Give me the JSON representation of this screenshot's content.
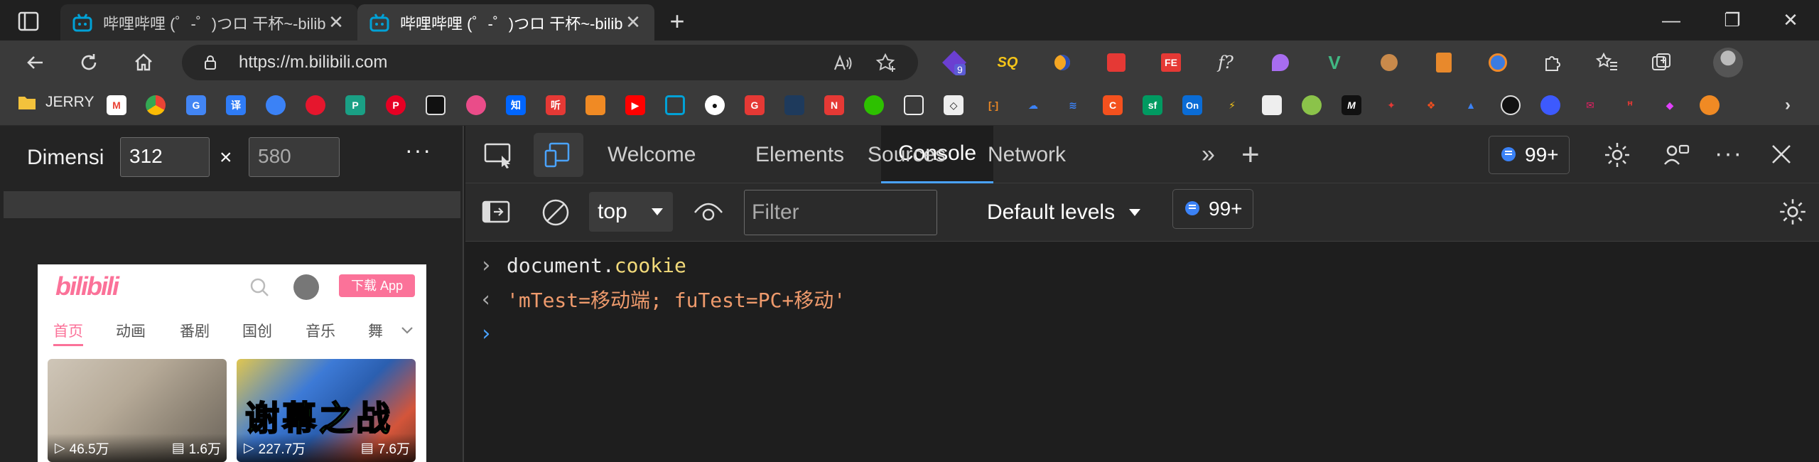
{
  "browser": {
    "tabs": [
      {
        "title": "哔哩哔哩 (゜-゜)つロ 干杯~-bilibili",
        "close": "✕"
      },
      {
        "title": "哔哩哔哩 (゜-゜)つロ 干杯~-bilibili",
        "close": "✕"
      }
    ],
    "new_tab": "+",
    "window": {
      "minimize": "—",
      "restore": "❐",
      "close": "✕"
    },
    "url": "https://m.bilibili.com",
    "extension_badge": "9",
    "bookmark_folder": "JERRY"
  },
  "device": {
    "dimension_label": "Dimensi",
    "width": "312",
    "height": "580",
    "x": "×",
    "more": "···"
  },
  "page": {
    "logo": "bilibili",
    "download_btn": "下载 App",
    "nav": [
      "首页",
      "动画",
      "番剧",
      "国创",
      "音乐",
      "舞"
    ],
    "cards": [
      {
        "views": "46.5万",
        "comments": "1.6万",
        "overlay": ""
      },
      {
        "views": "227.7万",
        "comments": "7.6万",
        "overlay": "谢幕之战"
      }
    ]
  },
  "devtools": {
    "tabs": [
      "Welcome",
      "Elements",
      "Console",
      "Sources",
      "Network"
    ],
    "more_tabs": "»",
    "add_tab": "+",
    "issues_count": "99+",
    "context": "top",
    "filter_placeholder": "Filter",
    "levels": "Default levels",
    "console_issues": "99+",
    "lines": {
      "input_obj": "document.",
      "input_prop": "cookie",
      "output": "'mTest=移动端; fuTest=PC+移动'"
    },
    "prompt_in": "›",
    "prompt_out": "‹",
    "prompt": "›"
  },
  "colors": {
    "accent": "#4aa3ff",
    "bilibili_pink": "#fb7299"
  }
}
